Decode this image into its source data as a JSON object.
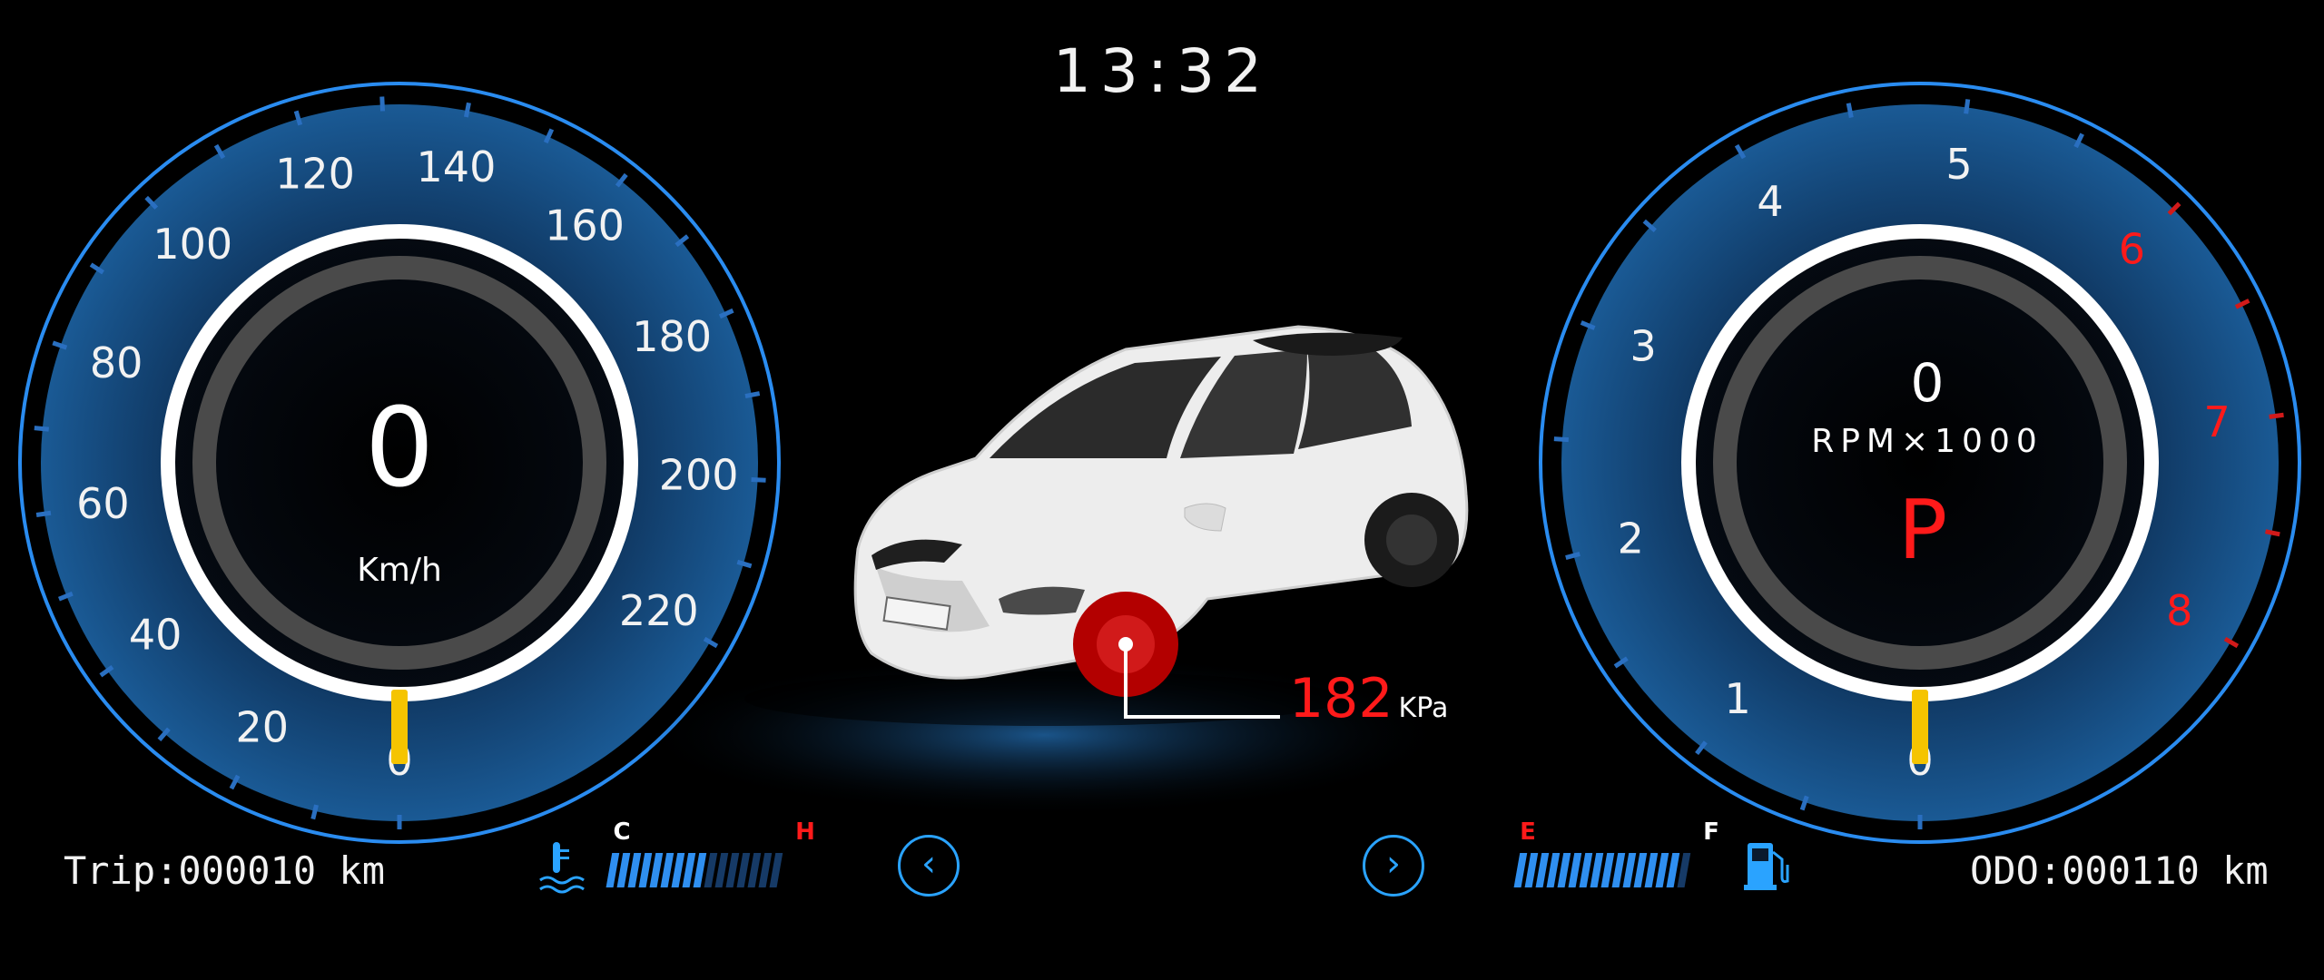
{
  "clock": "13:32",
  "speedometer": {
    "value": "0",
    "unit": "Km/h",
    "ticks": [
      "0",
      "20",
      "40",
      "60",
      "80",
      "100",
      "120",
      "140",
      "160",
      "180",
      "200",
      "220"
    ],
    "needle_value": 0
  },
  "tachometer": {
    "value": "0",
    "unit": "RPM×1000",
    "gear": "P",
    "ticks": [
      "0",
      "1",
      "2",
      "3",
      "4",
      "5",
      "6",
      "7",
      "8"
    ],
    "redline_from": 6,
    "needle_value": 0
  },
  "car": {
    "tire_pressure_value": "182",
    "tire_pressure_unit": "KPa"
  },
  "trip": "Trip:000010 km",
  "odo": "ODO:000110 km",
  "temp_gauge": {
    "cold_label": "C",
    "hot_label": "H",
    "level": 0.55
  },
  "fuel_gauge": {
    "empty_label": "E",
    "full_label": "F",
    "level": 0.9
  },
  "colors": {
    "accent": "#2aa3ff",
    "dial_fill": "#0f3c68",
    "needle": "#f5c400",
    "warning": "#ff1a1a",
    "ring": "#ffffff"
  }
}
